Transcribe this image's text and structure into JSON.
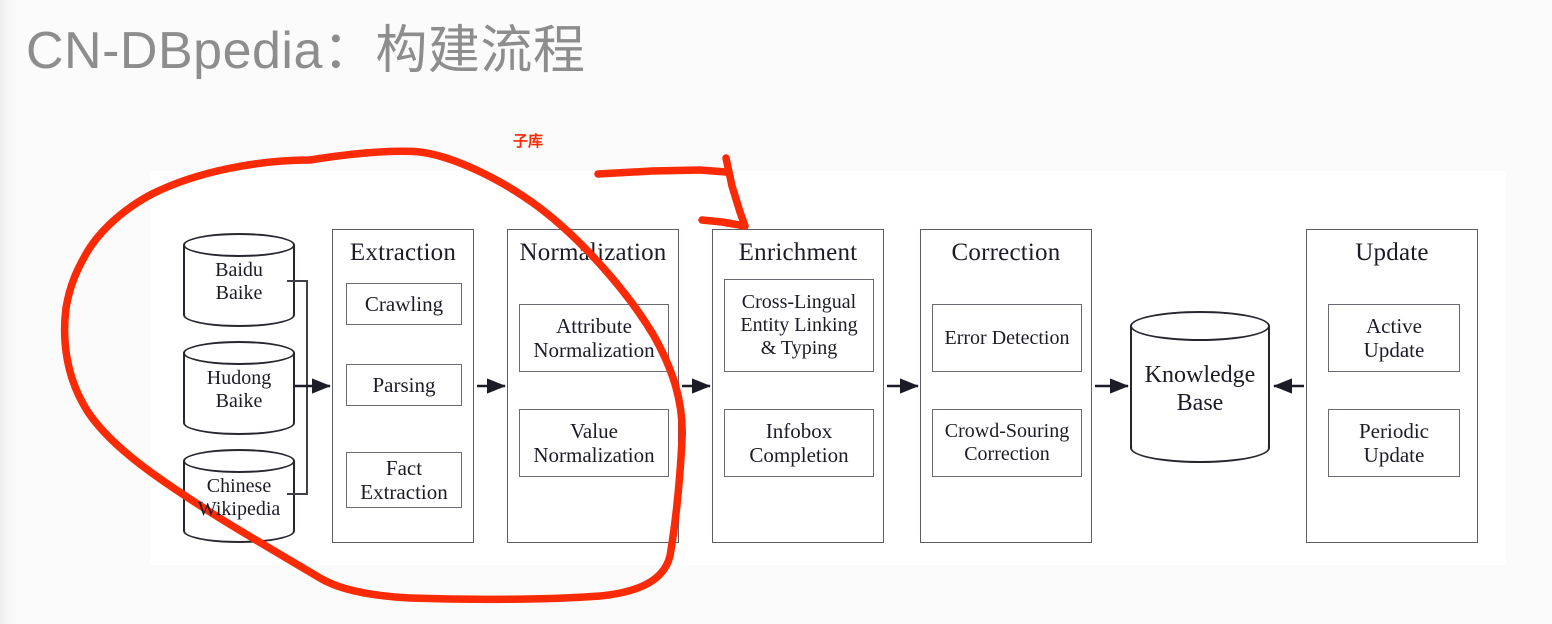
{
  "slide": {
    "title": "CN-DBpedia：构建流程"
  },
  "annotations": {
    "accent_color": "#fa2a05",
    "sub_library_label": "子库",
    "shapes": [
      "red-hand-drawn-ellipse",
      "red-hand-drawn-arrow"
    ]
  },
  "diagram": {
    "sources": [
      {
        "name": "baidu-baike",
        "line1": "Baidu",
        "line2": "Baike"
      },
      {
        "name": "hudong-baike",
        "line1": "Hudong",
        "line2": "Baike"
      },
      {
        "name": "chinese-wikipedia",
        "line1": "Chinese",
        "line2": "Wikipedia"
      }
    ],
    "stages": [
      {
        "name": "extraction",
        "title": "Extraction",
        "items": [
          {
            "line1": "Crawling",
            "line2": ""
          },
          {
            "line1": "Parsing",
            "line2": ""
          },
          {
            "line1": "Fact",
            "line2": "Extraction"
          }
        ]
      },
      {
        "name": "normalization",
        "title": "Normalization",
        "items": [
          {
            "line1": "Attribute",
            "line2": "Normalization"
          },
          {
            "line1": "Value",
            "line2": "Normalization"
          }
        ]
      },
      {
        "name": "enrichment",
        "title": "Enrichment",
        "items": [
          {
            "line1": "Cross-Lingual",
            "line2": "Entity Linking",
            "line3": "& Typing"
          },
          {
            "line1": "Infobox",
            "line2": "Completion"
          }
        ]
      },
      {
        "name": "correction",
        "title": "Correction",
        "items": [
          {
            "line1": "Error Detection",
            "line2": ""
          },
          {
            "line1": "Crowd-Souring",
            "line2": "Correction"
          }
        ]
      },
      {
        "name": "update",
        "title": "Update",
        "items": [
          {
            "line1": "Active",
            "line2": "Update"
          },
          {
            "line1": "Periodic",
            "line2": "Update"
          }
        ]
      }
    ],
    "knowledge_base": {
      "line1": "Knowledge",
      "line2": "Base"
    }
  }
}
